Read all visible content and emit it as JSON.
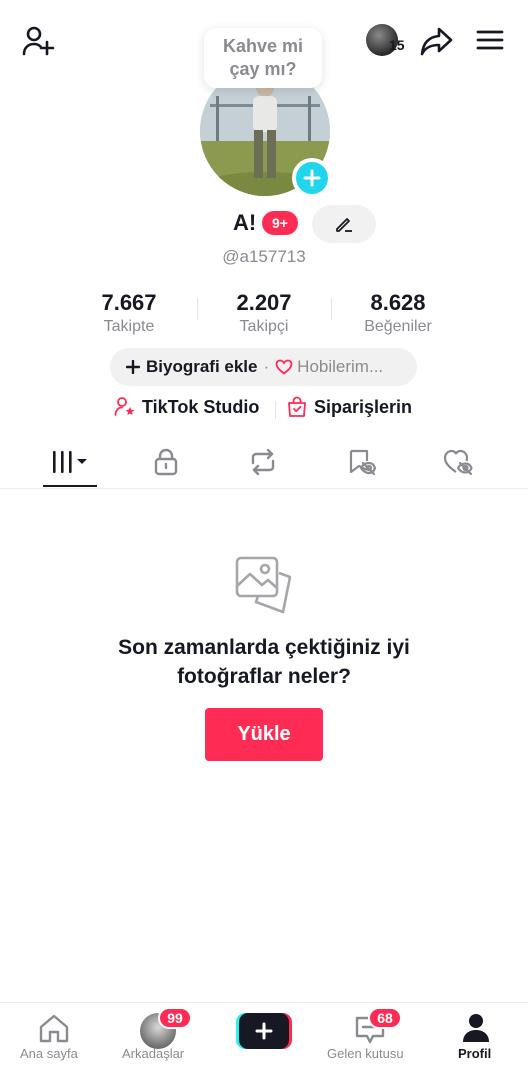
{
  "header": {
    "add_friend_icon": "person-plus-icon",
    "story_count": "15",
    "share_icon": "share-arrow-icon",
    "menu_icon": "hamburger-menu-icon"
  },
  "bubble": {
    "line1": "Kahve mi",
    "line2": "çay mı?"
  },
  "profile": {
    "name": "A!",
    "notification_count": "9+",
    "handle": "@a157713"
  },
  "stats": [
    {
      "value": "7.667",
      "label": "Takipte"
    },
    {
      "value": "2.207",
      "label": "Takipçi"
    },
    {
      "value": "8.628",
      "label": "Beğeniler"
    }
  ],
  "bio": {
    "add_label": "Biyografi ekle",
    "separator": "·",
    "hobbies_label": "Hobilerim..."
  },
  "links": {
    "studio_label": "TikTok Studio",
    "orders_label": "Siparişlerin"
  },
  "tabs": [
    {
      "name": "videos",
      "icon": "grid-icon"
    },
    {
      "name": "private",
      "icon": "lock-icon"
    },
    {
      "name": "reposts",
      "icon": "repost-icon"
    },
    {
      "name": "favorites",
      "icon": "bookmark-hidden-icon"
    },
    {
      "name": "liked",
      "icon": "heart-hidden-icon"
    }
  ],
  "empty_state": {
    "line1": "Son zamanlarda çektiğiniz iyi",
    "line2": "fotoğraflar neler?",
    "upload_label": "Yükle"
  },
  "bottom_nav": {
    "home_label": "Ana sayfa",
    "friends_label": "Arkadaşlar",
    "friends_badge": "99",
    "inbox_label": "Gelen kutusu",
    "inbox_badge": "68",
    "profile_label": "Profil"
  },
  "colors": {
    "accent": "#fe2c55",
    "cyan": "#25f4ee",
    "text": "#161823",
    "muted": "#8a8b91"
  }
}
